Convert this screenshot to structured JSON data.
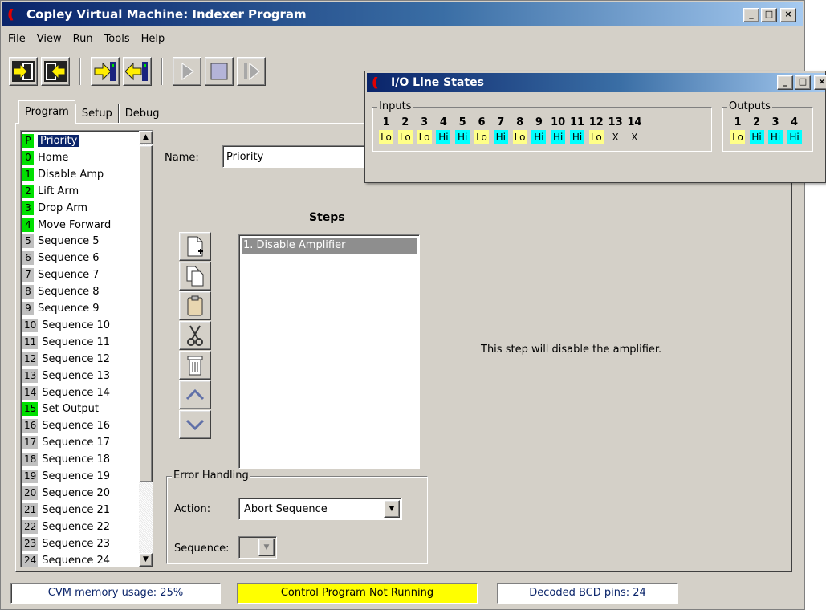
{
  "window": {
    "title": "Copley Virtual Machine: Indexer Program",
    "logo": "((",
    "controls": [
      "_",
      "□",
      "×"
    ]
  },
  "menu": [
    "File",
    "View",
    "Run",
    "Tools",
    "Help"
  ],
  "toolbar_icons": [
    "import-icon",
    "export-icon",
    "upload-icon",
    "download-icon",
    "run-icon",
    "stop-icon",
    "step-icon"
  ],
  "tabs": [
    "Program",
    "Setup",
    "Debug"
  ],
  "sequences": [
    {
      "num": "P",
      "label": "Priority",
      "color": "#00e000",
      "selected": true
    },
    {
      "num": "0",
      "label": "Home",
      "color": "#00e000"
    },
    {
      "num": "1",
      "label": "Disable Amp",
      "color": "#00e000"
    },
    {
      "num": "2",
      "label": "Lift Arm",
      "color": "#00e000"
    },
    {
      "num": "3",
      "label": "Drop Arm",
      "color": "#00e000"
    },
    {
      "num": "4",
      "label": "Move Forward",
      "color": "#00e000"
    },
    {
      "num": "5",
      "label": "Sequence 5",
      "color": "#c0c0c0"
    },
    {
      "num": "6",
      "label": "Sequence 6",
      "color": "#c0c0c0"
    },
    {
      "num": "7",
      "label": "Sequence 7",
      "color": "#c0c0c0"
    },
    {
      "num": "8",
      "label": "Sequence 8",
      "color": "#c0c0c0"
    },
    {
      "num": "9",
      "label": "Sequence 9",
      "color": "#c0c0c0"
    },
    {
      "num": "10",
      "label": "Sequence 10",
      "color": "#c0c0c0"
    },
    {
      "num": "11",
      "label": "Sequence 11",
      "color": "#c0c0c0"
    },
    {
      "num": "12",
      "label": "Sequence 12",
      "color": "#c0c0c0"
    },
    {
      "num": "13",
      "label": "Sequence 13",
      "color": "#c0c0c0"
    },
    {
      "num": "14",
      "label": "Sequence 14",
      "color": "#c0c0c0"
    },
    {
      "num": "15",
      "label": "Set Output",
      "color": "#00e000"
    },
    {
      "num": "16",
      "label": "Sequence 16",
      "color": "#c0c0c0"
    },
    {
      "num": "17",
      "label": "Sequence 17",
      "color": "#c0c0c0"
    },
    {
      "num": "18",
      "label": "Sequence 18",
      "color": "#c0c0c0"
    },
    {
      "num": "19",
      "label": "Sequence 19",
      "color": "#c0c0c0"
    },
    {
      "num": "20",
      "label": "Sequence 20",
      "color": "#c0c0c0"
    },
    {
      "num": "21",
      "label": "Sequence 21",
      "color": "#c0c0c0"
    },
    {
      "num": "22",
      "label": "Sequence 22",
      "color": "#c0c0c0"
    },
    {
      "num": "23",
      "label": "Sequence 23",
      "color": "#c0c0c0"
    },
    {
      "num": "24",
      "label": "Sequence 24",
      "color": "#c0c0c0"
    }
  ],
  "name": {
    "label": "Name:",
    "value": "Priority"
  },
  "steps": {
    "title": "Steps",
    "items": [
      "1. Disable Amplifier"
    ],
    "description": "This step will disable the amplifier.",
    "buttons": [
      "new-step-icon",
      "copy-icon",
      "paste-icon",
      "cut-icon",
      "delete-icon",
      "move-up-icon",
      "move-down-icon"
    ]
  },
  "error_handling": {
    "legend": "Error Handling",
    "action_label": "Action:",
    "action_value": "Abort Sequence",
    "sequence_label": "Sequence:",
    "sequence_value": ""
  },
  "status": {
    "memory": "CVM memory usage: 25%",
    "program": "Control Program Not Running",
    "program_color": "#ffff00",
    "bcd": "Decoded BCD pins: 24"
  },
  "io": {
    "title": "I/O Line States",
    "inputs_legend": "Inputs",
    "outputs_legend": "Outputs",
    "inputs": [
      {
        "n": "1",
        "s": "Lo"
      },
      {
        "n": "2",
        "s": "Lo"
      },
      {
        "n": "3",
        "s": "Lo"
      },
      {
        "n": "4",
        "s": "Hi"
      },
      {
        "n": "5",
        "s": "Hi"
      },
      {
        "n": "6",
        "s": "Lo"
      },
      {
        "n": "7",
        "s": "Hi"
      },
      {
        "n": "8",
        "s": "Lo"
      },
      {
        "n": "9",
        "s": "Hi"
      },
      {
        "n": "10",
        "s": "Hi"
      },
      {
        "n": "11",
        "s": "Hi"
      },
      {
        "n": "12",
        "s": "Lo"
      },
      {
        "n": "13",
        "s": "X"
      },
      {
        "n": "14",
        "s": "X"
      }
    ],
    "outputs": [
      {
        "n": "1",
        "s": "Lo"
      },
      {
        "n": "2",
        "s": "Hi"
      },
      {
        "n": "3",
        "s": "Hi"
      },
      {
        "n": "4",
        "s": "Hi"
      }
    ]
  }
}
